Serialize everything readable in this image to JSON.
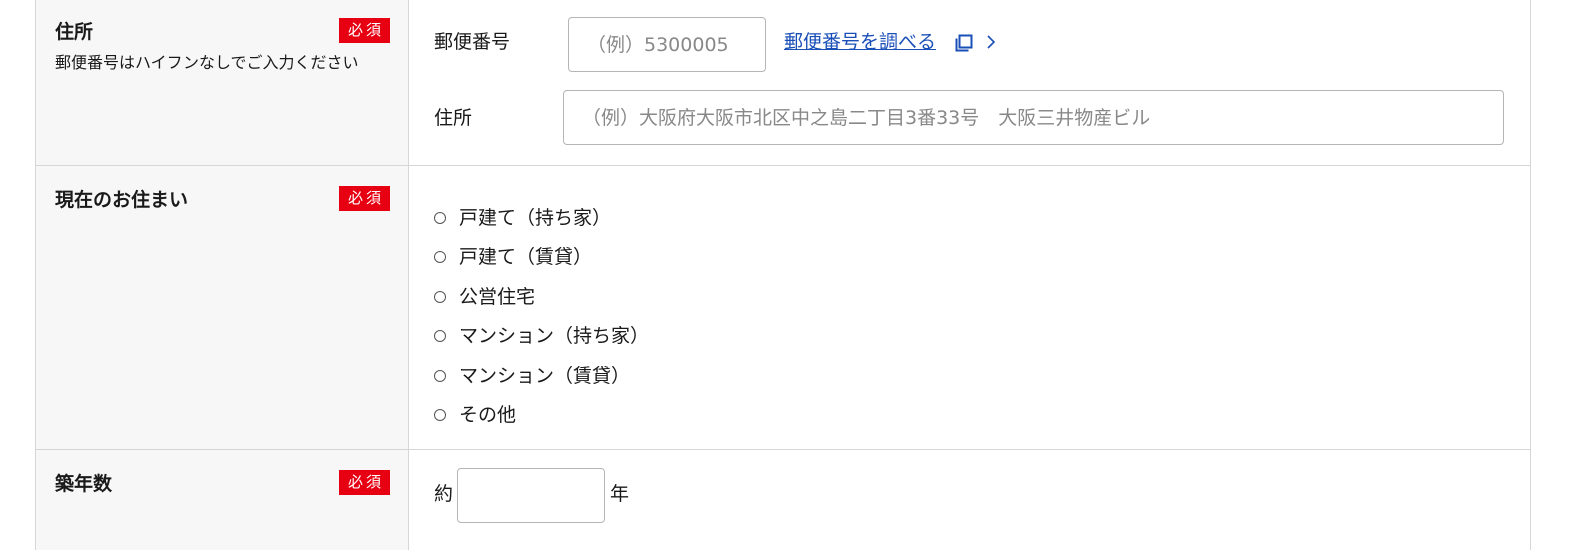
{
  "address": {
    "title": "住所",
    "required_badge": "必須",
    "note": "郵便番号はハイフンなしでご入力ください",
    "zip_label": "郵便番号",
    "zip_placeholder": "（例）5300005",
    "zip_value": "",
    "lookup_link": "郵便番号を調べる",
    "address_label": "住所",
    "address_placeholder": "（例）大阪府大阪市北区中之島二丁目3番33号　大阪三井物産ビル",
    "address_value": "",
    "icons": [
      "new-window-icon",
      "chevron-right-icon"
    ]
  },
  "residence": {
    "title": "現在のお住まい",
    "required_badge": "必須",
    "options": [
      "戸建て（持ち家）",
      "戸建て（賃貸）",
      "公営住宅",
      "マンション（持ち家）",
      "マンション（賃貸）",
      "その他"
    ],
    "selected": null
  },
  "building_age": {
    "title": "築年数",
    "required_badge": "必須",
    "prefix": "約",
    "suffix": "年",
    "value": ""
  },
  "colors": {
    "required_bg": "#e60012",
    "link": "#1a4fb7",
    "header_bg": "#f7f7f7",
    "border": "#d6d6d6"
  }
}
